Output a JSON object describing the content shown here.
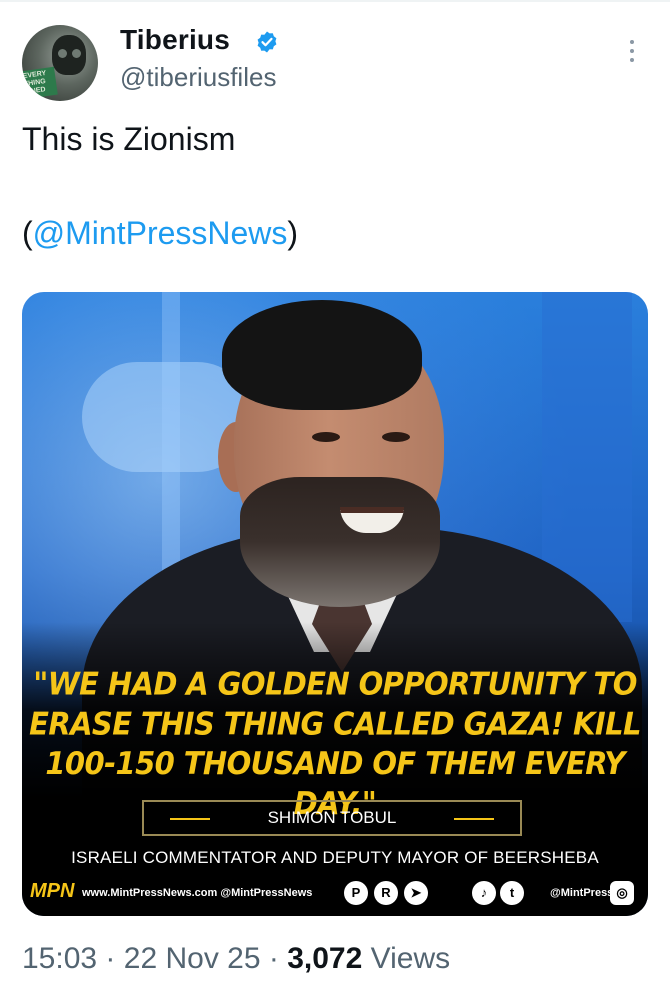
{
  "author": {
    "name": "Tiberius",
    "handle": "@tiberiusfiles",
    "verified_color": "#1d9bf0",
    "avatar_text": "EVERY THING ...NED"
  },
  "tweet": {
    "text": "This is Zionism",
    "mention_open": "(",
    "mention": "@MintPressNews",
    "mention_close": ")"
  },
  "media": {
    "quote": "\"WE HAD A GOLDEN OPPORTUNITY TO ERASE THIS THING CALLED GAZA! KILL 100-150 THOUSAND OF THEM EVERY DAY.\"",
    "speaker": "SHIMON TOBUL",
    "role": "ISRAELI COMMENTATOR AND DEPUTY MAYOR OF BEERSHEBA",
    "brand": "MPN",
    "website": "www.MintPressNews.com @MintPressNews",
    "social_handle": "@MintPress",
    "quote_color": "#f5c518"
  },
  "meta": {
    "time": "15:03",
    "sep1": "·",
    "date": "22 Nov 25",
    "sep2": "·",
    "views_count": "3,072",
    "views_label": "Views"
  }
}
